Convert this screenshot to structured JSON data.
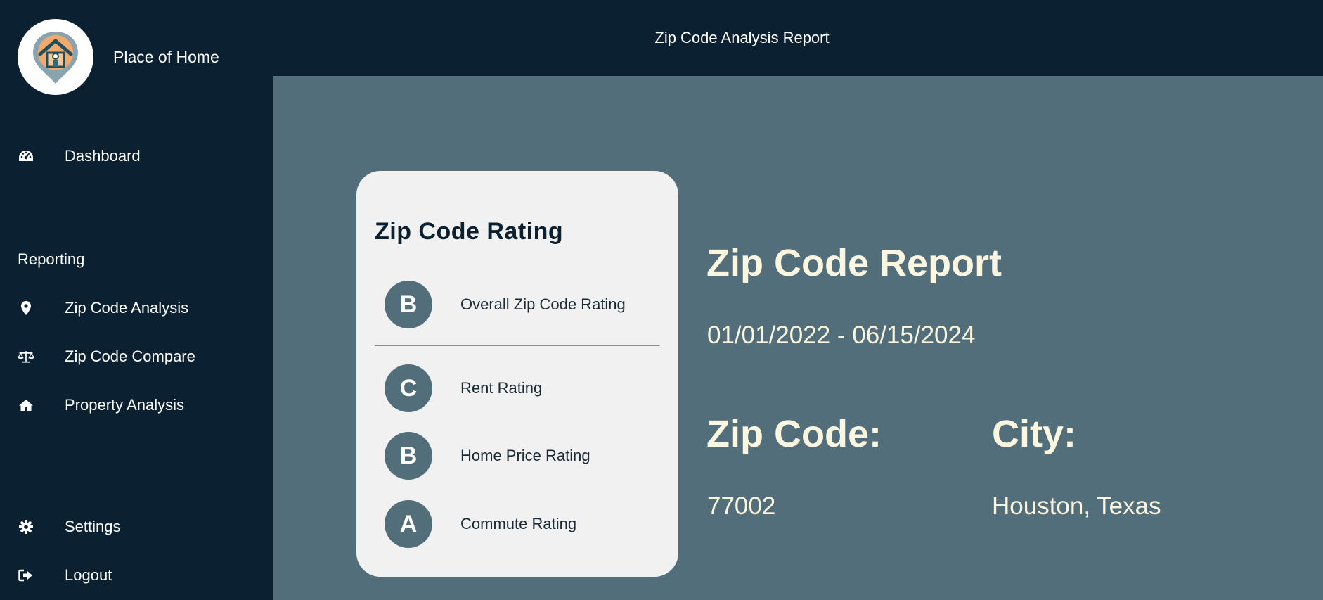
{
  "app": {
    "brand_name": "Place of Home"
  },
  "header": {
    "title": "Zip Code Analysis Report"
  },
  "sidebar": {
    "dashboard": {
      "label": "Dashboard",
      "icon": "dashboard-gauge-icon"
    },
    "section_label": "Reporting",
    "items": [
      {
        "label": "Zip Code Analysis",
        "icon": "map-marker-icon"
      },
      {
        "label": "Zip Code Compare",
        "icon": "balance-scale-icon"
      },
      {
        "label": "Property Analysis",
        "icon": "home-icon"
      }
    ],
    "settings": {
      "label": "Settings",
      "icon": "gear-icon"
    },
    "logout": {
      "label": "Logout",
      "icon": "sign-out-icon"
    }
  },
  "rating_card": {
    "title": "Zip Code Rating",
    "overall": {
      "grade": "B",
      "label": "Overall Zip Code Rating"
    },
    "ratings": [
      {
        "grade": "C",
        "label": "Rent Rating"
      },
      {
        "grade": "B",
        "label": "Home Price Rating"
      },
      {
        "grade": "A",
        "label": "Commute Rating"
      }
    ]
  },
  "report": {
    "title": "Zip Code Report",
    "date_range": "01/01/2022 - 06/15/2024",
    "zip_label": "Zip Code:",
    "zip_value": "77002",
    "city_label": "City:",
    "city_value": "Houston, Texas"
  },
  "colors": {
    "sidebar_bg": "#0b2131",
    "main_bg": "#516e7a",
    "card_bg": "#f1f1f1",
    "accent_text": "#fbf6df"
  }
}
